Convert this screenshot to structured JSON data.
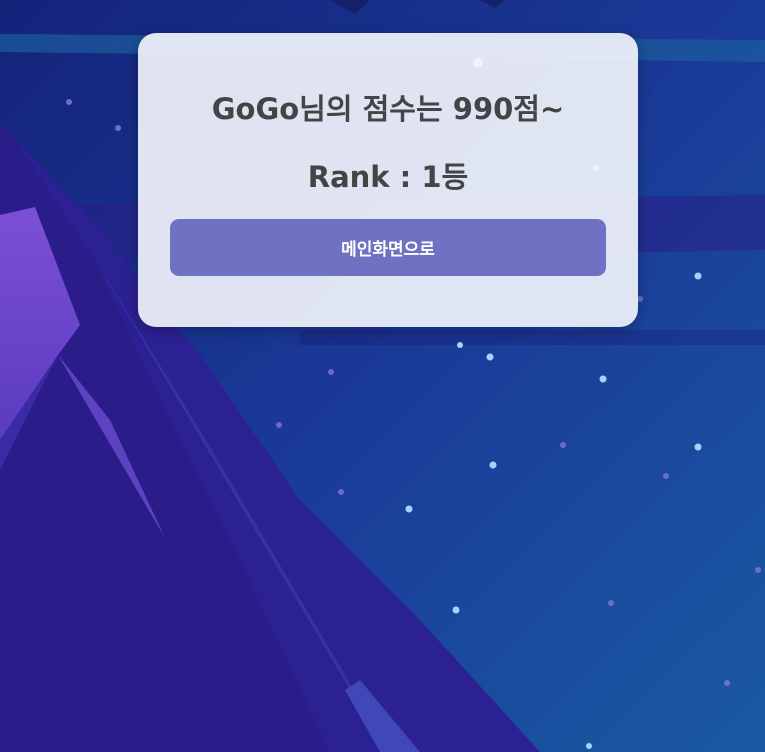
{
  "result": {
    "score_message": "GoGo님의 점수는 990점~",
    "rank_message": "Rank : 1등",
    "main_button_label": "메인화면으로"
  }
}
